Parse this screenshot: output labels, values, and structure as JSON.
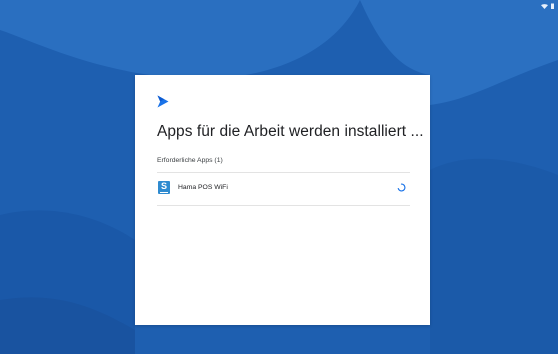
{
  "title": "Apps für die Arbeit werden installiert ...",
  "section_label": "Erforderliche Apps (1)",
  "apps": [
    {
      "name": "Hama POS WiFi",
      "icon_letter": "S",
      "status": "installing"
    }
  ],
  "icons": {
    "header": "google-play-icon",
    "app": "app-icon",
    "progress": "loading-spinner-icon",
    "status": [
      "wifi-icon",
      "battery-icon"
    ]
  },
  "colors": {
    "background": "#1e5fb0",
    "card": "#ffffff",
    "accent": "#1a73e8",
    "app_icon": "#2f8bd0"
  }
}
